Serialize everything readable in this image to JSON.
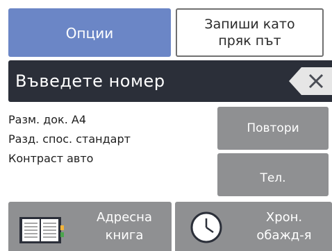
{
  "top_buttons": {
    "options": "Опции",
    "shortcut_line1": "Запиши като",
    "shortcut_line2": "пряк път"
  },
  "number_entry": {
    "prompt": "Въведете номер",
    "backspace_icon": "backspace-icon"
  },
  "settings": [
    "Разм. док. A4",
    "Разд. спос. стандарт",
    "Контраст авто"
  ],
  "side_buttons": {
    "redial": "Повтори",
    "tel": "Тел."
  },
  "bottom_buttons": {
    "address_book_line1": "Адресна",
    "address_book_line2": "книга",
    "address_book_icon": "address-book-icon",
    "history_line1": "Хрон.",
    "history_line2": "обажд-я",
    "history_icon": "clock-icon"
  },
  "colors": {
    "accent": "#6b86c6",
    "dark_bar": "#2b2f39",
    "gray_button": "#8f9092"
  }
}
